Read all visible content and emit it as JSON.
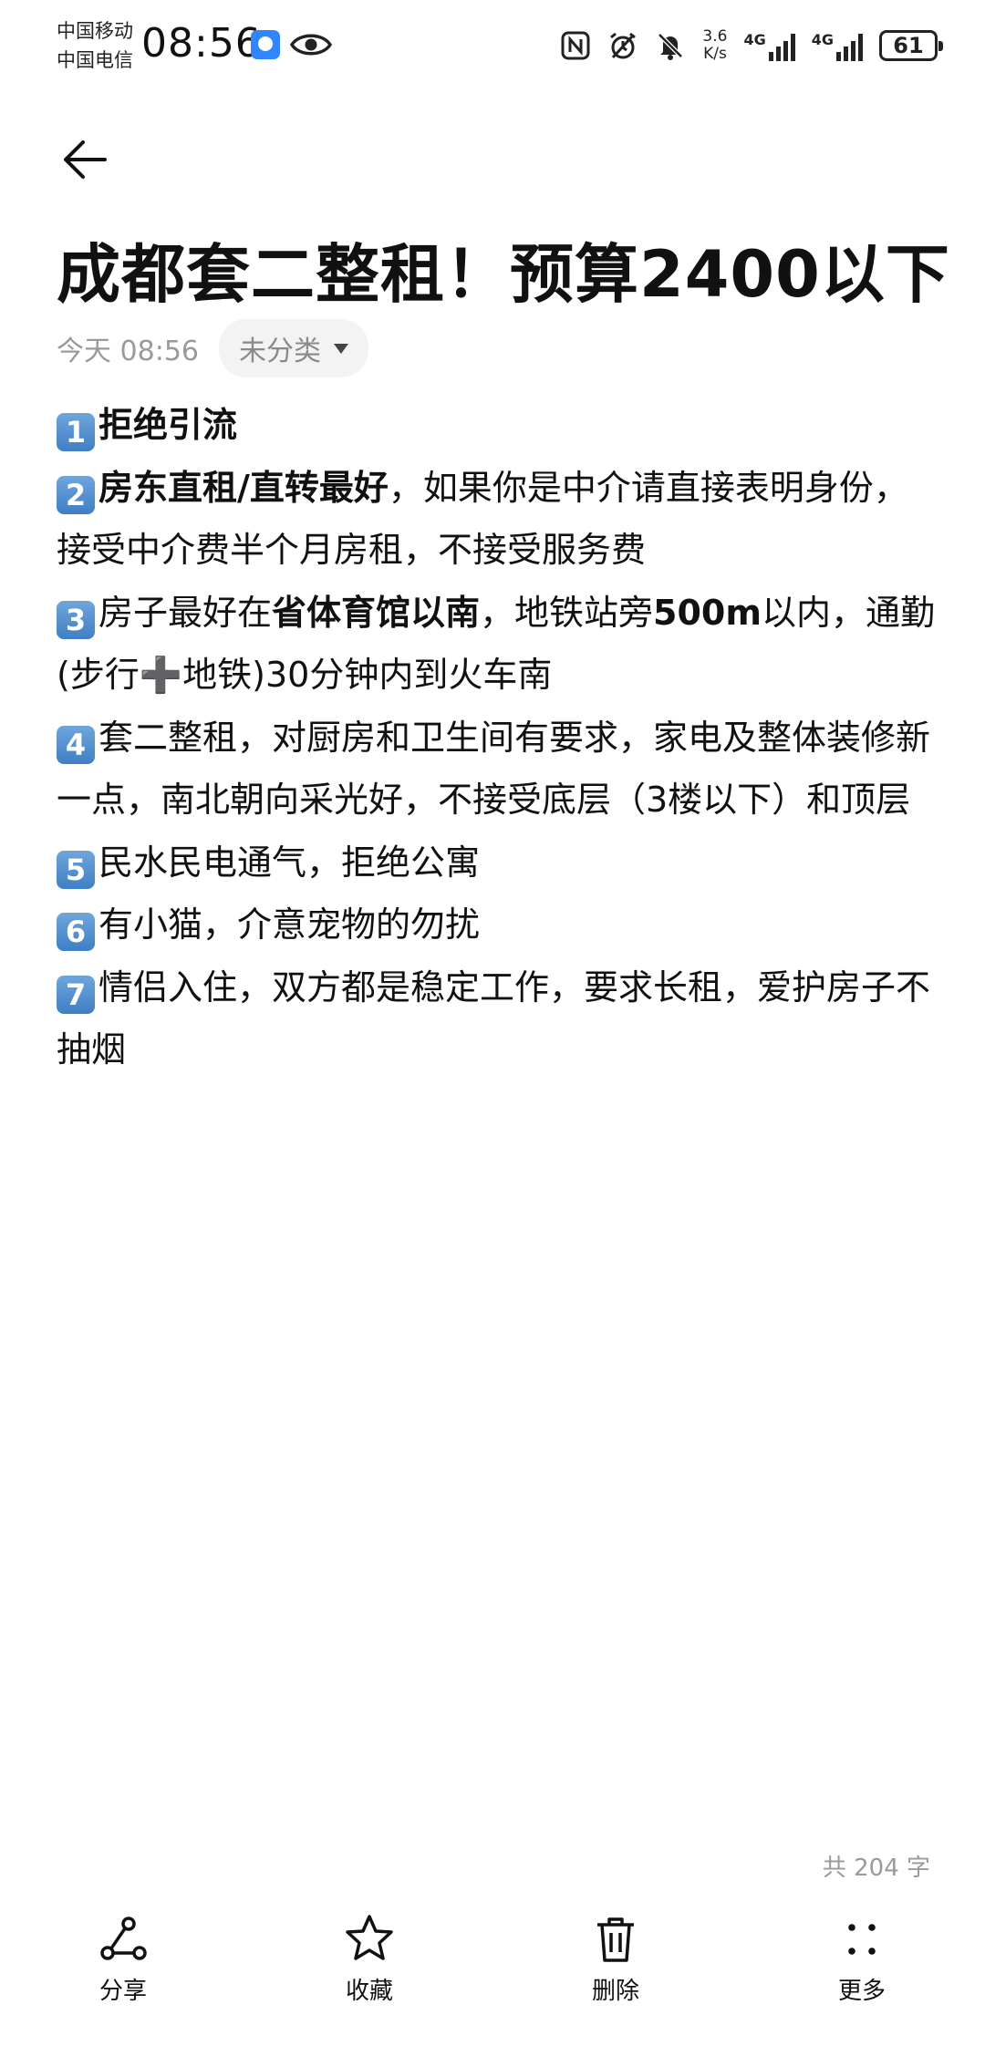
{
  "status_bar": {
    "carrier_1": "中国移动",
    "carrier_2": "中国电信",
    "time": "08:56",
    "net_speed_value": "3.6",
    "net_speed_unit": "K/s",
    "network_1": "4G",
    "network_2": "4G",
    "battery": "61"
  },
  "note": {
    "title": "成都套二整租！预算2400以下",
    "date": "今天 08:56",
    "category": "未分类",
    "items": [
      {
        "num": "1",
        "bold": "拒绝引流",
        "text": ""
      },
      {
        "num": "2",
        "bold": "房东直租/直转最好",
        "text": "，如果你是中介请直接表明身份，接受中介费半个月房租，不接受服务费"
      },
      {
        "num": "3",
        "pre": "房子最好在",
        "bold": "省体育馆以南",
        "mid": "，地铁站旁",
        "bold2": "500m",
        "post": "以内，通勤(步行➕地铁)30分钟内到火车南"
      },
      {
        "num": "4",
        "text": "套二整租，对厨房和卫生间有要求，家电及整体装修新一点，南北朝向采光好，不接受底层（3楼以下）和顶层"
      },
      {
        "num": "5",
        "text": "民水民电通气，拒绝公寓"
      },
      {
        "num": "6",
        "text": "有小猫，介意宠物的勿扰"
      },
      {
        "num": "7",
        "text": "情侣入住，双方都是稳定工作，要求长租，爱护房子不抽烟"
      }
    ],
    "word_count": "共 204 字"
  },
  "toolbar": {
    "share": "分享",
    "favorite": "收藏",
    "delete": "删除",
    "more": "更多"
  },
  "icons": [
    "eye-icon",
    "nfc-icon",
    "alarm-icon",
    "mute-icon",
    "back-arrow-icon",
    "share-icon",
    "star-icon",
    "trash-icon",
    "more-icon"
  ]
}
